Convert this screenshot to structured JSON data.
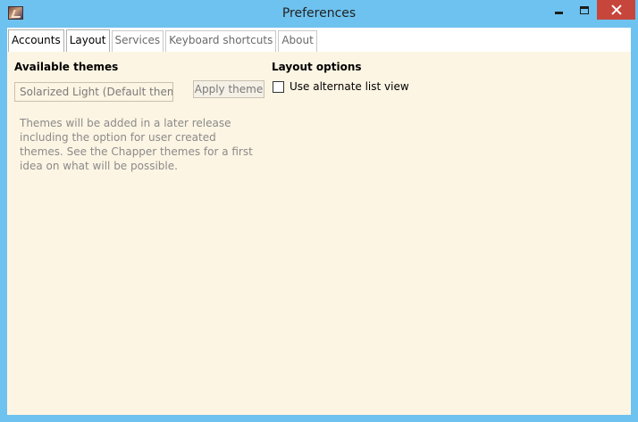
{
  "window": {
    "title": "Preferences",
    "icon": "app-icon",
    "controls": [
      "minimize-icon",
      "maximize-icon",
      "close-icon"
    ],
    "colors": {
      "frame": "#6ec2ef",
      "close": "#c7463c",
      "content_bg": "#fdf5e3"
    }
  },
  "tabs": [
    {
      "label": "Accounts",
      "active": true
    },
    {
      "label": "Layout",
      "active": true
    },
    {
      "label": "Services",
      "active": false
    },
    {
      "label": "Keyboard shortcuts",
      "active": false
    },
    {
      "label": "About",
      "active": false
    }
  ],
  "themes": {
    "title": "Available themes",
    "selected": "Solarized Light (Default theme)",
    "apply_label": "Apply theme",
    "info": "Themes will be added in a later release including the option for user created themes. See the Chapper themes for a first idea on what will be possible."
  },
  "layout": {
    "title": "Layout options",
    "checkbox_label": "Use alternate list view",
    "checked": false
  }
}
